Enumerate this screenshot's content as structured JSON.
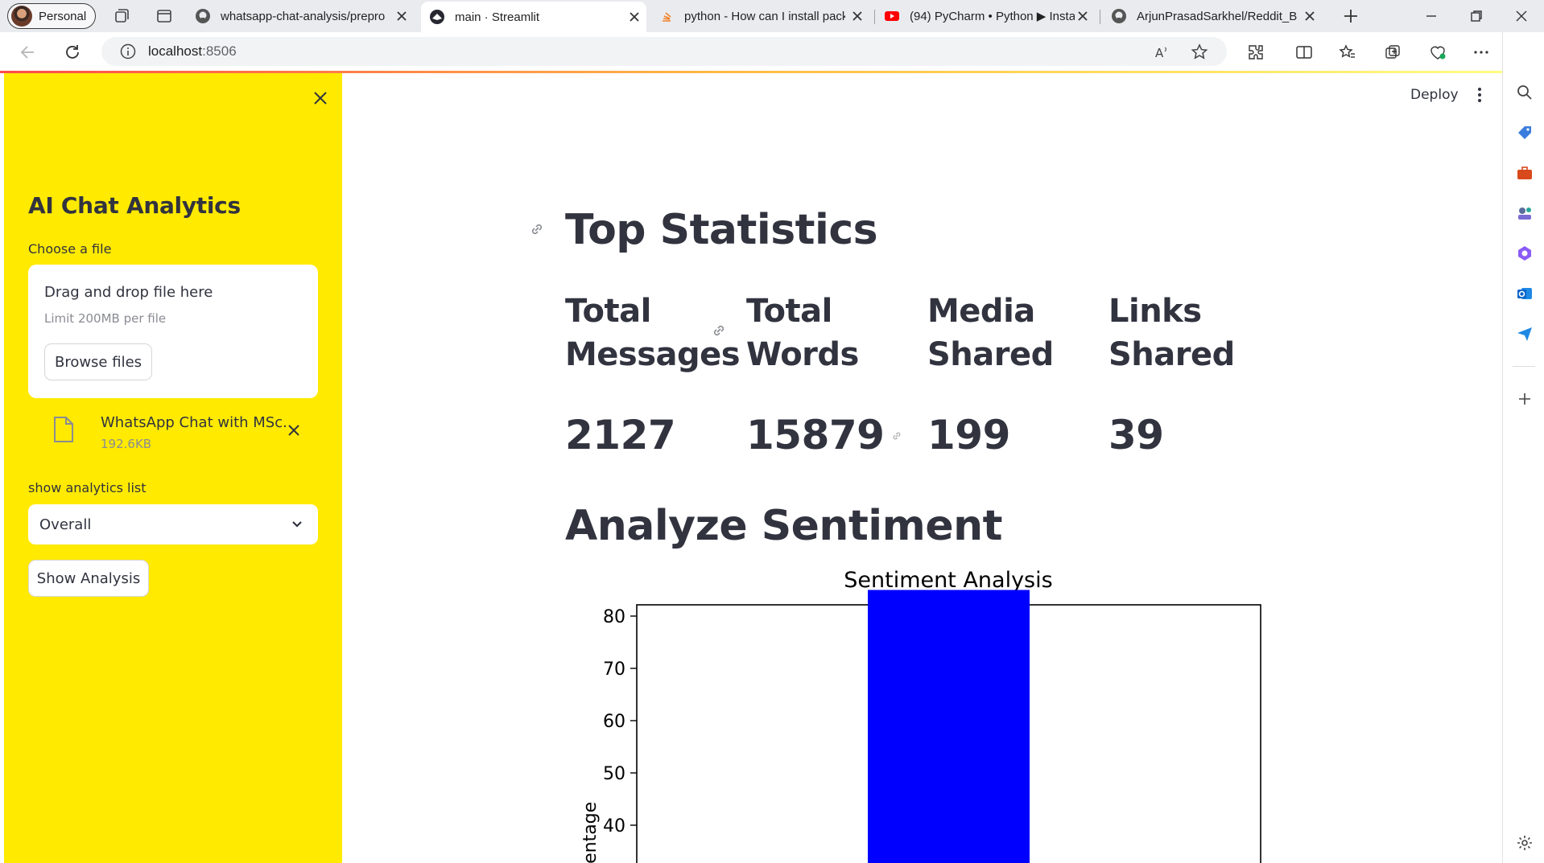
{
  "browser": {
    "profile_label": "Personal",
    "tabs": [
      {
        "title": "whatsapp-chat-analysis/prepro",
        "favicon": "github-icon",
        "active": false
      },
      {
        "title": "main · Streamlit",
        "favicon": "streamlit-icon",
        "active": true
      },
      {
        "title": "python - How can I install pack",
        "favicon": "stackoverflow-icon",
        "active": false
      },
      {
        "title": "(94) PyCharm • Python ▶ Insta",
        "favicon": "youtube-icon",
        "active": false
      },
      {
        "title": "ArjunPrasadSarkhel/Reddit_Bo",
        "favicon": "github-icon",
        "active": false
      }
    ],
    "url_host": "localhost",
    "url_port": ":8506"
  },
  "sidebar": {
    "title": "AI Chat Analytics",
    "upload_label": "Choose a file",
    "dropzone_main": "Drag and drop file here",
    "dropzone_sub": "Limit 200MB per file",
    "browse_button": "Browse files",
    "file_name": "WhatsApp Chat with MSc...",
    "file_size": "192.6KB",
    "select_label": "show analytics list",
    "select_value": "Overall",
    "analysis_button": "Show Analysis",
    "accent_color": "#ffea00"
  },
  "header": {
    "deploy_label": "Deploy"
  },
  "main": {
    "stats_heading": "Top Statistics",
    "metrics": [
      {
        "label_line1": "Total",
        "label_line2": "Messages",
        "value": "2127"
      },
      {
        "label_line1": "Total",
        "label_line2": "Words",
        "value": "15879"
      },
      {
        "label_line1": "Media",
        "label_line2": "Shared",
        "value": "199"
      },
      {
        "label_line1": "Links",
        "label_line2": "Shared",
        "value": "39"
      }
    ],
    "sentiment_heading": "Analyze Sentiment"
  },
  "chart_data": {
    "type": "bar",
    "title": "Sentiment Analysis",
    "ylabel": "centage",
    "yticks": [
      "40",
      "50",
      "60",
      "70",
      "80"
    ],
    "ylim_visible": [
      38,
      89
    ],
    "values": [
      85
    ],
    "bar_color": "#0000ff"
  }
}
